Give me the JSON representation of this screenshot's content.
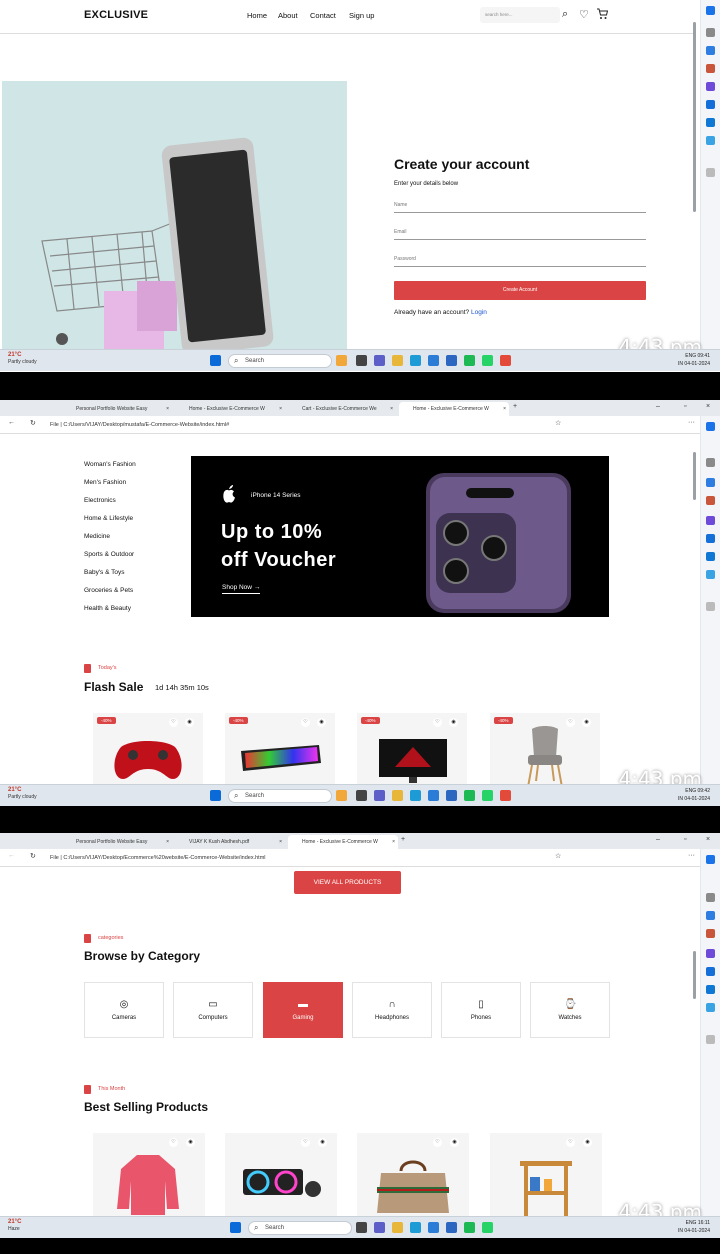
{
  "clock": "4:43 pm",
  "panel1": {
    "logo": "EXCLUSIVE",
    "nav": [
      "Home",
      "About",
      "Contact",
      "Sign up"
    ],
    "search_placeholder": "search here...",
    "form": {
      "title": "Create your account",
      "subtitle": "Enter your details below",
      "name_placeholder": "Name",
      "email_placeholder": "Email",
      "password_placeholder": "Password",
      "button": "Create Account",
      "have_account": "Already have an account?",
      "login_link": "Login"
    },
    "taskbar": {
      "temp": "21°C",
      "weather": "Partly cloudy",
      "search": "Search",
      "lang": "ENG",
      "region": "IN",
      "time": "09:41",
      "date": "04-01-2024"
    }
  },
  "panel2": {
    "tabs": [
      "Personal Portfolio Website Easy",
      "Home - Exclusive E-Commerce W",
      "Cart - Exclusive E-Commerce We",
      "Home - Exclusive E-Commerce W"
    ],
    "url": "C:/Users/VIJAY/Desktop/mustafa/E-Commerce-Website/index.html#",
    "file_label": "File",
    "categories": [
      "Woman's Fashion",
      "Men's Fashion",
      "Electronics",
      "Home & Lifestyle",
      "Medicine",
      "Sports & Outdoor",
      "Baby's & Toys",
      "Groceries & Pets",
      "Health & Beauty"
    ],
    "banner": {
      "model": "iPhone 14 Series",
      "headline_1": "Up to 10%",
      "headline_2": "off Voucher",
      "shop": "Shop Now"
    },
    "section_tag": "Today's",
    "section_title": "Flash Sale",
    "timer": "1d 14h 35m 10s",
    "discounts": [
      "-40%",
      "-40%",
      "-40%",
      "-40%"
    ],
    "taskbar": {
      "temp": "21°C",
      "weather": "Partly cloudy",
      "search": "Search",
      "lang": "ENG",
      "region": "IN",
      "time": "09:42",
      "date": "04-01-2024"
    }
  },
  "panel3": {
    "tabs": [
      "Personal Portfolio Website Easy",
      "VIJAY K Kush Abdhesh.pdf",
      "Home - Exclusive E-Commerce W"
    ],
    "url": "C:/Users/VIJAY/Desktop/Ecommerce%20website/E-Commerce-Website/index.html",
    "file_label": "File",
    "view_all": "VIEW ALL PRODUCTS",
    "cat_tag": "categories",
    "cat_title": "Browse by Category",
    "category_boxes": [
      "Cameras",
      "Computers",
      "Gaming",
      "Headphones",
      "Phones",
      "Watches"
    ],
    "selected_category": "Gaming",
    "month_tag": "This Month",
    "month_title": "Best Selling Products",
    "taskbar": {
      "temp": "21°C",
      "weather": "Haze",
      "search": "Search",
      "lang": "ENG",
      "region": "IN",
      "time": "16:11",
      "date": "04-01-2024"
    }
  },
  "colors": {
    "accent": "#db4444",
    "link": "#1a53d6",
    "banner_bg": "#000000"
  }
}
